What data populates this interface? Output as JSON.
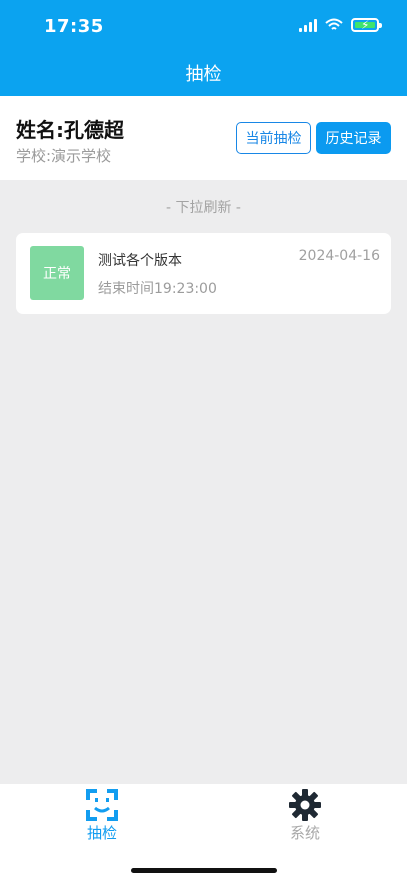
{
  "status_bar": {
    "time": "17:35"
  },
  "header": {
    "title": "抽检"
  },
  "user": {
    "name": "姓名:孔德超",
    "school": "学校:演示学校"
  },
  "actions": {
    "current_label": "当前抽检",
    "history_label": "历史记录"
  },
  "list": {
    "refresh_hint": "- 下拉刷新 -",
    "items": [
      {
        "status": "正常",
        "title": "测试各个版本",
        "end_time": "结束时间19:23:00",
        "date": "2024-04-16"
      }
    ]
  },
  "tabs": [
    {
      "label": "抽检",
      "icon": "face-scan-icon",
      "active": true
    },
    {
      "label": "系统",
      "icon": "gear-icon",
      "active": false
    }
  ],
  "colors": {
    "primary": "#0ba3f0",
    "status_normal": "#80d9a0",
    "background": "#ededee"
  }
}
